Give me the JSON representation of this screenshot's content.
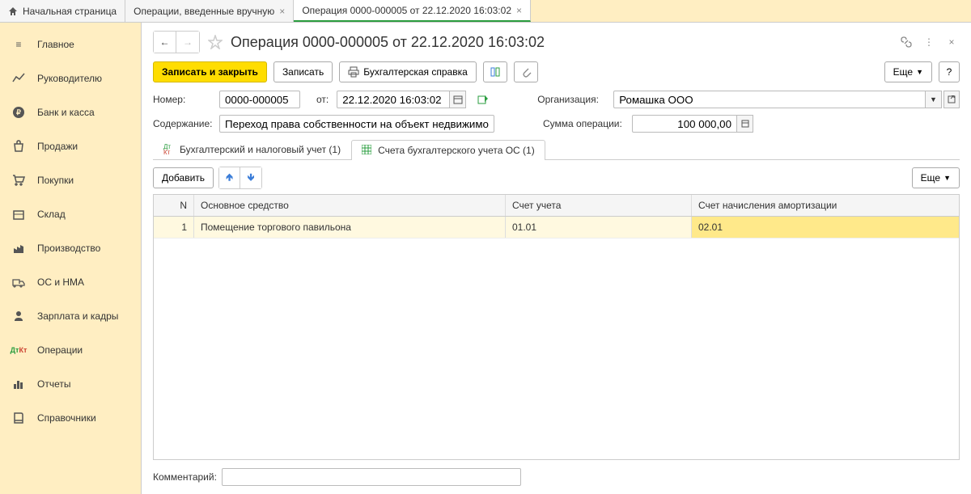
{
  "tabs": {
    "home": "Начальная страница",
    "ops": "Операции, введенные вручную",
    "active": "Операция 0000-000005 от 22.12.2020 16:03:02"
  },
  "sidebar": [
    "Главное",
    "Руководителю",
    "Банк и касса",
    "Продажи",
    "Покупки",
    "Склад",
    "Производство",
    "ОС и НМА",
    "Зарплата и кадры",
    "Операции",
    "Отчеты",
    "Справочники"
  ],
  "title": "Операция 0000-000005 от 22.12.2020 16:03:02",
  "toolbar": {
    "save_close": "Записать и закрыть",
    "save": "Записать",
    "print": "Бухгалтерская справка",
    "more": "Еще",
    "help": "?"
  },
  "form": {
    "number_label": "Номер:",
    "number": "0000-000005",
    "date_label": "от:",
    "date": "22.12.2020 16:03:02",
    "org_label": "Организация:",
    "org": "Ромашка ООО",
    "desc_label": "Содержание:",
    "desc": "Переход права собственности на объект недвижимости",
    "sum_label": "Сумма операции:",
    "sum": "100 000,00"
  },
  "inner_tabs": {
    "tab1": "Бухгалтерский и налоговый учет (1)",
    "tab2": "Счета бухгалтерского учета ОС (1)"
  },
  "grid": {
    "add": "Добавить",
    "more": "Еще",
    "cols": {
      "n": "N",
      "asset": "Основное средство",
      "acct": "Счет учета",
      "dep": "Счет начисления амортизации"
    },
    "rows": [
      {
        "n": "1",
        "asset": "Помещение торгового павильона",
        "acct": "01.01",
        "dep": "02.01"
      }
    ]
  },
  "comment_label": "Комментарий:",
  "comment": ""
}
